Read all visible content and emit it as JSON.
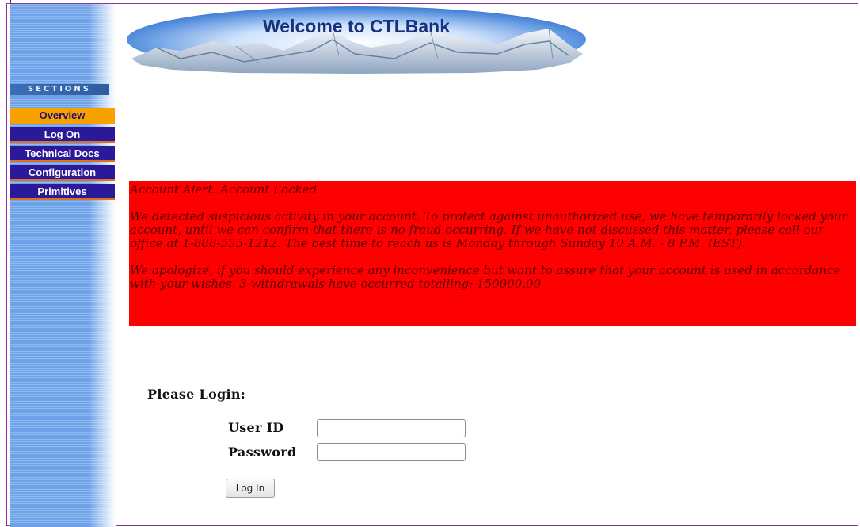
{
  "banner": {
    "title": "Welcome to CTLBank"
  },
  "sidebar": {
    "sections_label": "SECTIONS",
    "items": [
      {
        "label": "Overview",
        "active": true
      },
      {
        "label": "Log On",
        "active": false
      },
      {
        "label": "Technical Docs",
        "active": false
      },
      {
        "label": "Configuration",
        "active": false
      },
      {
        "label": "Primitives",
        "active": false
      }
    ]
  },
  "alert": {
    "title": "Account Alert: Account Locked",
    "body": "We detected suspicious activity in your account. To protect against unauthorized use, we have temporarily locked your account, until we can confirm that there is no fraud occurring. If we have not discussed this matter, please call our office at 1-888-555-1212. The best time to reach us is Monday through Sunday 10 A.M. - 8 P.M. (EST).",
    "footer": "We apologize, if you should experience any inconvenience but want to assure that your account is used in accordance with your wishes. 3 withdrawals have occurred totalling: 150000.00",
    "background_color": "#ff0000"
  },
  "login": {
    "heading": "Please Login:",
    "user_id_label": "User ID",
    "user_id_value": "",
    "password_label": "Password",
    "password_value": "",
    "submit_label": "Log In"
  },
  "colors": {
    "nav_background": "#2a1a99",
    "nav_active": "#f7a000",
    "banner_text": "#16317d"
  }
}
